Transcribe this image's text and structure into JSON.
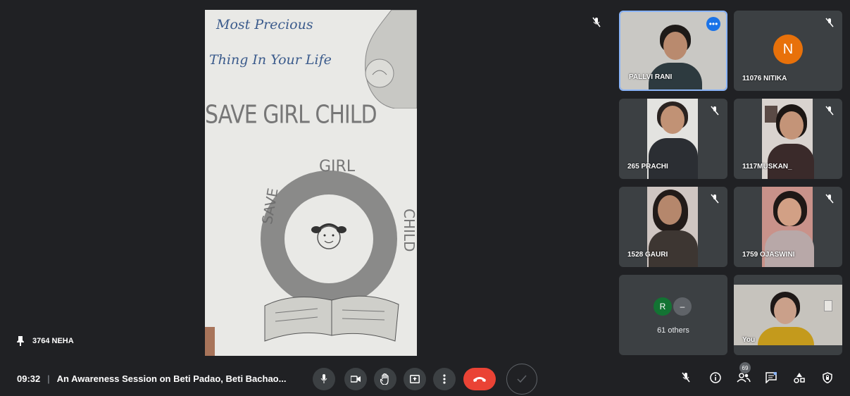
{
  "stage": {
    "presenter_name": "3764 NEHA",
    "drawing": {
      "line1": "Most Precious",
      "line2": "Thing In Your Life",
      "headline": "SAVE GIRL CHILD",
      "top_word": "GIRL",
      "left_word": "SAVE",
      "right_word": "CHILD"
    }
  },
  "participants": [
    {
      "name": "PALLVI RANI",
      "highlighted": true
    },
    {
      "name": "11076 NITIKA",
      "avatar_letter": "N",
      "avatar_color": "#e8710a"
    },
    {
      "name": "265 PRACHI"
    },
    {
      "name": "1117MUSKAN_"
    },
    {
      "name": "1528 GAURI"
    },
    {
      "name": "1759 OJASWINI"
    },
    {
      "name": "61 others",
      "avatar_letters": [
        "R",
        "–"
      ]
    },
    {
      "name": "You"
    }
  ],
  "bottom_bar": {
    "time": "09:32",
    "meeting_title": "An Awareness Session on Beti Padao, Beti Bachao...",
    "people_count": "69"
  },
  "colors": {
    "background": "#202124",
    "tile": "#3c4043",
    "end_call": "#ea4335",
    "active_border": "#8ab4f8",
    "more_button": "#1a73e8"
  }
}
